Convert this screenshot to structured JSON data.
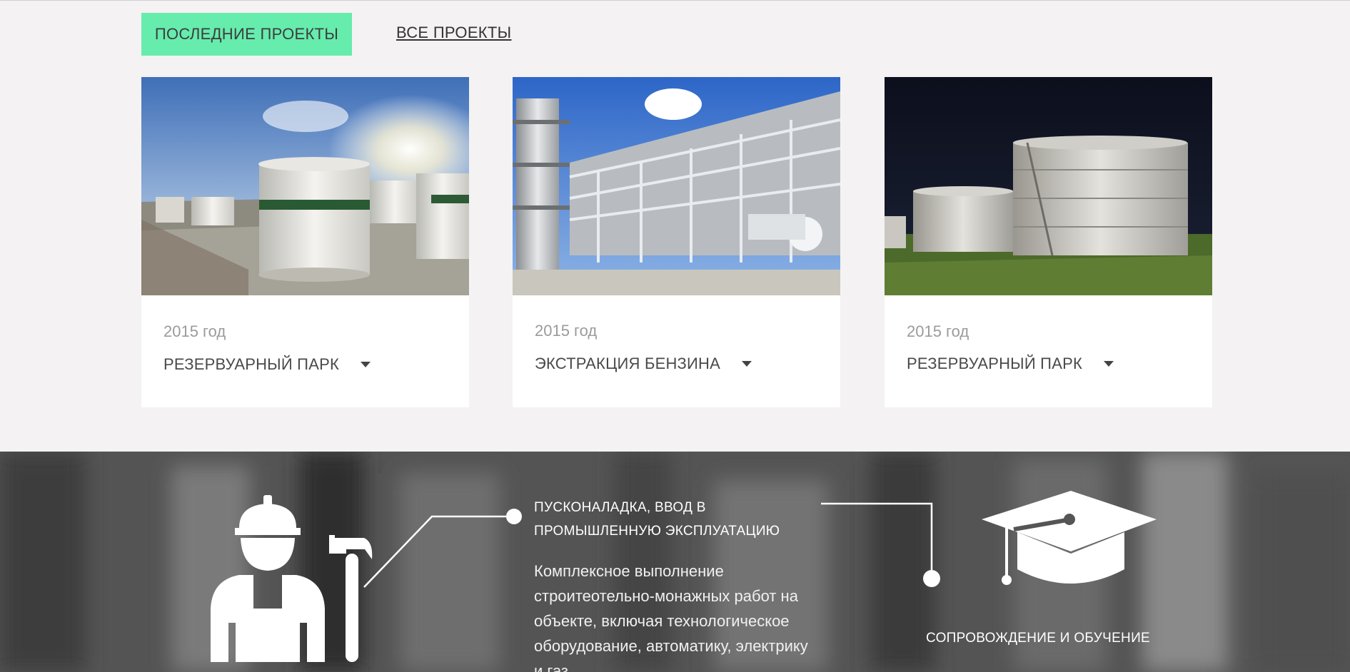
{
  "tabs": {
    "active_label": "ПОСЛЕДНИЕ ПРОЕКТЫ",
    "all_label": "ВСЕ ПРОЕКТЫ"
  },
  "projects": [
    {
      "year": "2015 год",
      "title": "РЕЗЕРВУАРНЫЙ ПАРК",
      "image": "tank-farm-photo"
    },
    {
      "year": "2015 год",
      "title": "ЭКСТРАКЦИЯ БЕНЗИНА",
      "image": "refinery-photo"
    },
    {
      "year": "2015 год",
      "title": "РЕЗЕРВУАРНЫЙ ПАРК",
      "image": "night-tank-photo"
    }
  ],
  "services": {
    "commissioning": {
      "title_line1": "ПУСКОНАЛАДКА, ВВОД В",
      "title_line2": "ПРОМЫШЛЕННУЮ ЭКСПЛУАТАЦИЮ",
      "desc_line1": "Комплексное выполнение",
      "desc_line2": "строитеотельно-монажных работ на",
      "desc_line3": "объекте, включая технологическое",
      "desc_line4": "оборудование, автоматику, электрику",
      "desc_line5": "и газ.",
      "icon": "worker-icon"
    },
    "training": {
      "title": "СОПРОВОЖДЕНИЕ И ОБУЧЕНИЕ",
      "icon": "graduation-cap-icon"
    }
  },
  "colors": {
    "accent": "#66ecad",
    "page_bg": "#f4f2f3",
    "dark_section": "#595959"
  }
}
